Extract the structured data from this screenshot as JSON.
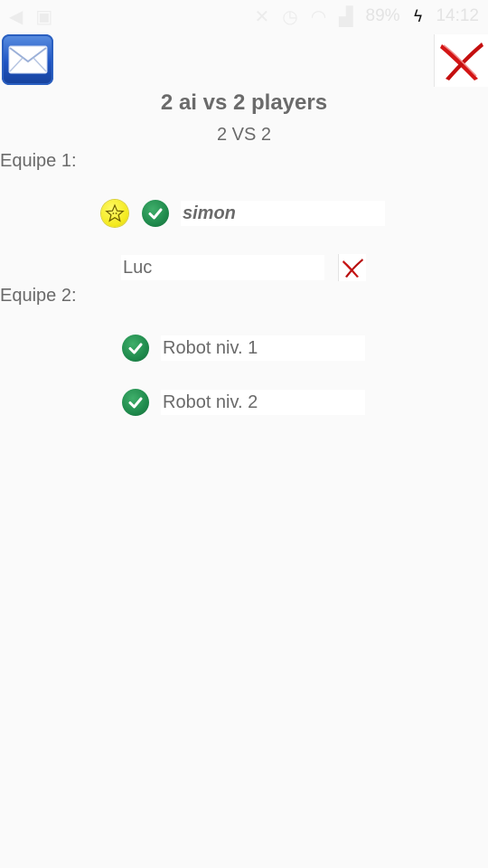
{
  "status_bar": {
    "battery_text": "89%",
    "time": "14:12",
    "icons": [
      "volume-icon",
      "image-icon",
      "mute-icon",
      "alarm-icon",
      "wifi-icon",
      "signal-icon",
      "charging-icon"
    ]
  },
  "header": {
    "mail_icon": "mail-icon",
    "close_icon": "close-icon",
    "title": "2 ai vs 2 players",
    "subtitle": "2 VS 2"
  },
  "teams": [
    {
      "label": "Equipe 1:",
      "players": [
        {
          "name": "simon",
          "owner": true,
          "ready": true
        },
        {
          "name": "Luc",
          "removable": true
        }
      ]
    },
    {
      "label": "Equipe 2:",
      "players": [
        {
          "name": "Robot niv. 1",
          "ready": true
        },
        {
          "name": "Robot niv. 2",
          "ready": true
        }
      ]
    }
  ],
  "colors": {
    "background": "#fafafa",
    "text": "#6a6a6a",
    "check_green": "#1f8a4c",
    "star_yellow": "#f4ea1e",
    "close_red": "#d31515",
    "mail_blue": "#1f55c4"
  }
}
